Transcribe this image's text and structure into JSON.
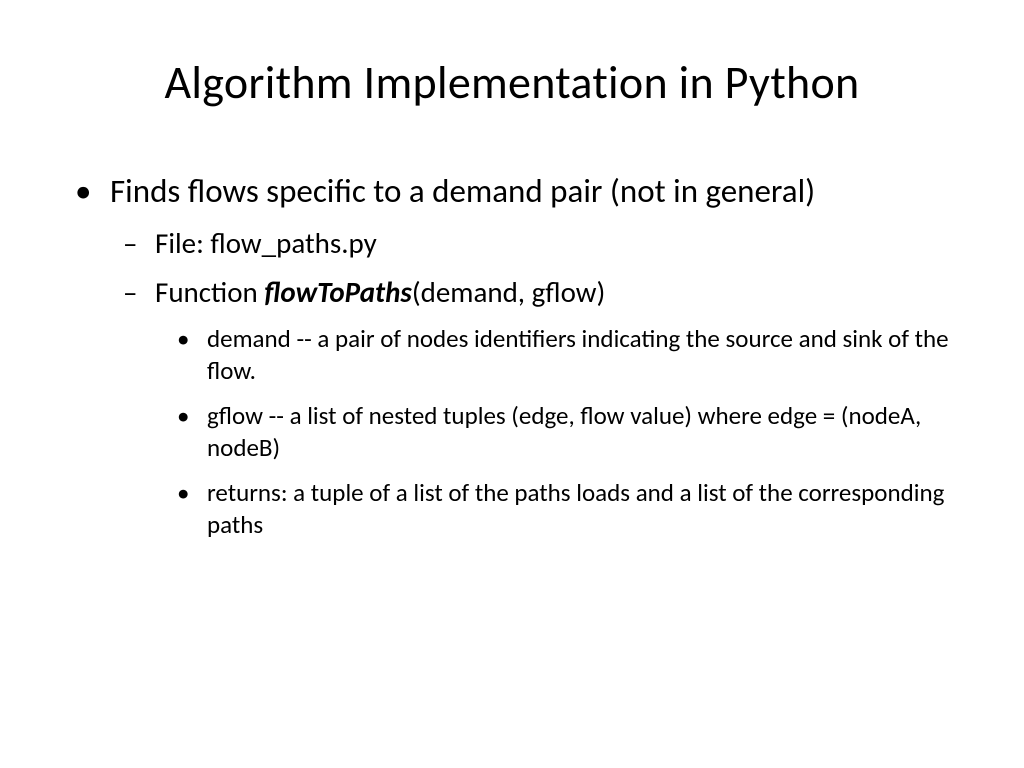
{
  "title": "Algorithm Implementation in Python",
  "bullet1": "Finds flows specific to a demand pair (not in general)",
  "sub1": "File: flow_paths.py",
  "sub2_prefix": "Function ",
  "sub2_fn": "flowToPaths",
  "sub2_suffix": "(demand, gflow)",
  "param1": " demand  -- a pair of nodes identifiers indicating the source and sink of the flow.",
  "param2": " gflow -- a list of nested tuples (edge, flow value) where edge = (nodeA, nodeB)",
  "param3": "returns: a tuple of a list of the paths loads and a list of the corresponding paths"
}
